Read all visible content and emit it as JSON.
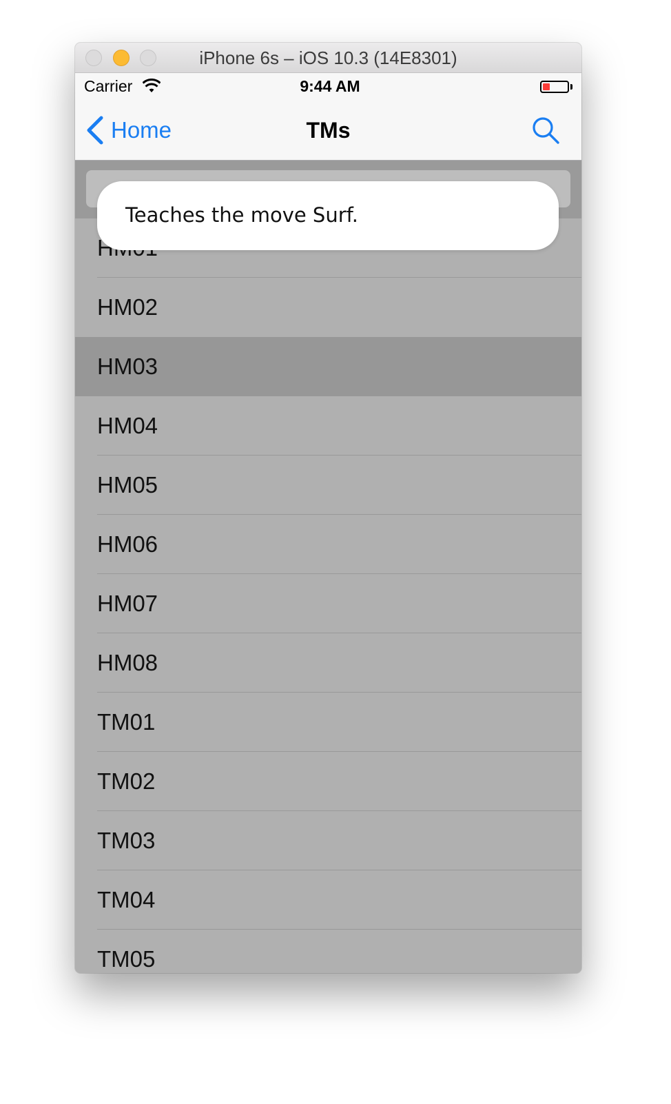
{
  "window": {
    "title": "iPhone 6s – iOS 10.3 (14E8301)"
  },
  "status_bar": {
    "carrier": "Carrier",
    "time": "9:44 AM",
    "battery_level": 0.3,
    "battery_color": "#fc3d39"
  },
  "nav_bar": {
    "back_label": "Home",
    "title": "TMs",
    "search_icon": "search-icon",
    "tint_color": "#1a7ef2"
  },
  "toast": {
    "message": "Teaches the move Surf."
  },
  "list": {
    "selected_label": "HM03",
    "items": [
      {
        "label": "HM01"
      },
      {
        "label": "HM02"
      },
      {
        "label": "HM03"
      },
      {
        "label": "HM04"
      },
      {
        "label": "HM05"
      },
      {
        "label": "HM06"
      },
      {
        "label": "HM07"
      },
      {
        "label": "HM08"
      },
      {
        "label": "TM01"
      },
      {
        "label": "TM02"
      },
      {
        "label": "TM03"
      },
      {
        "label": "TM04"
      },
      {
        "label": "TM05"
      }
    ]
  }
}
